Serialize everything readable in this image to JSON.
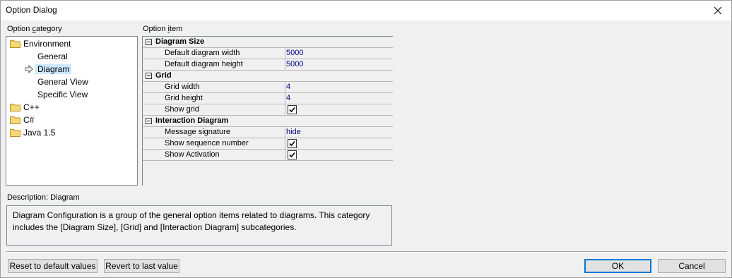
{
  "window": {
    "title": "Option Dialog"
  },
  "labels": {
    "category_prefix": "Option ",
    "category_accel": "c",
    "category_rest": "ategory",
    "item_prefix": "Option ",
    "item_accel": "i",
    "item_rest": "tem",
    "description": "Description: Diagram"
  },
  "tree": {
    "environment": "Environment",
    "general": "General",
    "diagram": "Diagram",
    "general_view": "General View",
    "specific_view": "Specific View",
    "cpp": "C++",
    "csharp": "C#",
    "java": "Java 1.5"
  },
  "grid": {
    "diagram_size": {
      "title": "Diagram Size",
      "width_label": "Default diagram width",
      "width_value": "5000",
      "height_label": "Default diagram height",
      "height_value": "5000"
    },
    "grid": {
      "title": "Grid",
      "width_label": "Grid width",
      "width_value": "4",
      "height_label": "Grid height",
      "height_value": "4",
      "show_label": "Show grid",
      "show_checked": true
    },
    "interaction": {
      "title": "Interaction Diagram",
      "msg_sig_label": "Message signature",
      "msg_sig_value": "hide",
      "seq_label": "Show sequence number",
      "seq_checked": true,
      "act_label": "Show Activation",
      "act_checked": true
    }
  },
  "description": {
    "line1": "Diagram Configuration is a group of the general option items related to diagrams. This category",
    "line2": "includes the [Diagram Size], [Grid] and [Interaction Diagram] subcategories."
  },
  "buttons": {
    "reset": "Reset to default values",
    "revert": "Revert to last value",
    "ok": "OK",
    "cancel": "Cancel"
  },
  "icons": {
    "folder": "folder-icon",
    "arrow": "arrow-right-icon",
    "close": "close-icon",
    "check": "checkmark-icon"
  }
}
